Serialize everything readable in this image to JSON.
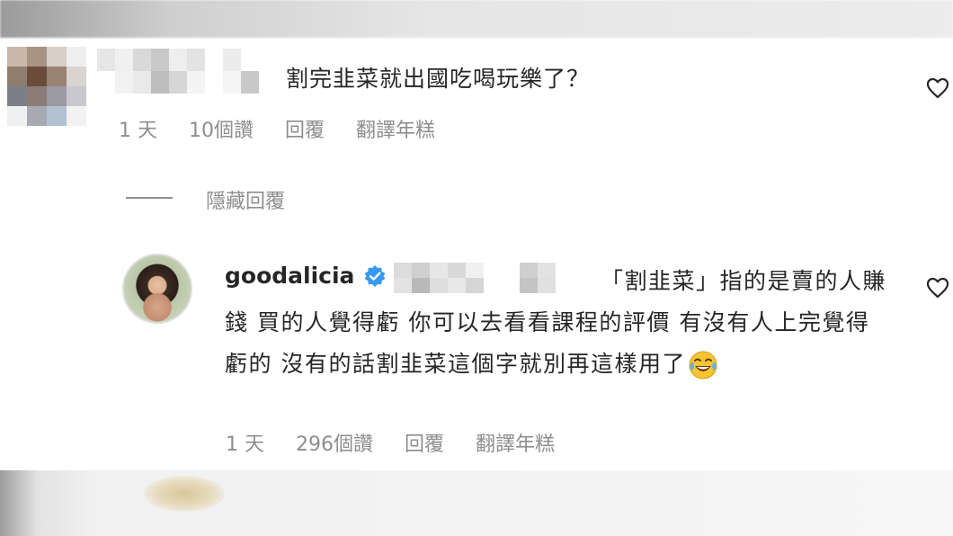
{
  "comments": [
    {
      "text": "割完韭菜就出國吃喝玩樂了？",
      "time": "1 天",
      "likes": "10個讚",
      "reply": "回覆",
      "translate": "翻譯年糕"
    },
    {
      "username": "goodalicia",
      "verified": true,
      "text": "「割韭菜」指的是賣的人賺錢 買的人覺得虧 你可以去看看課程的評價 有沒有人上完覺得虧的 沒有的話割韭菜這個字就別再這樣用了",
      "emoji": "face-with-tears-of-joy",
      "time": "1 天",
      "likes": "296個讚",
      "reply": "回覆",
      "translate": "翻譯年糕"
    }
  ],
  "hide_replies": "隱藏回覆",
  "icons": [
    "heart-icon",
    "verified-badge-icon",
    "face-with-tears-of-joy-icon"
  ],
  "colors": {
    "text": "#262626",
    "meta": "#8e8e8e",
    "verified": "#3897f0"
  }
}
